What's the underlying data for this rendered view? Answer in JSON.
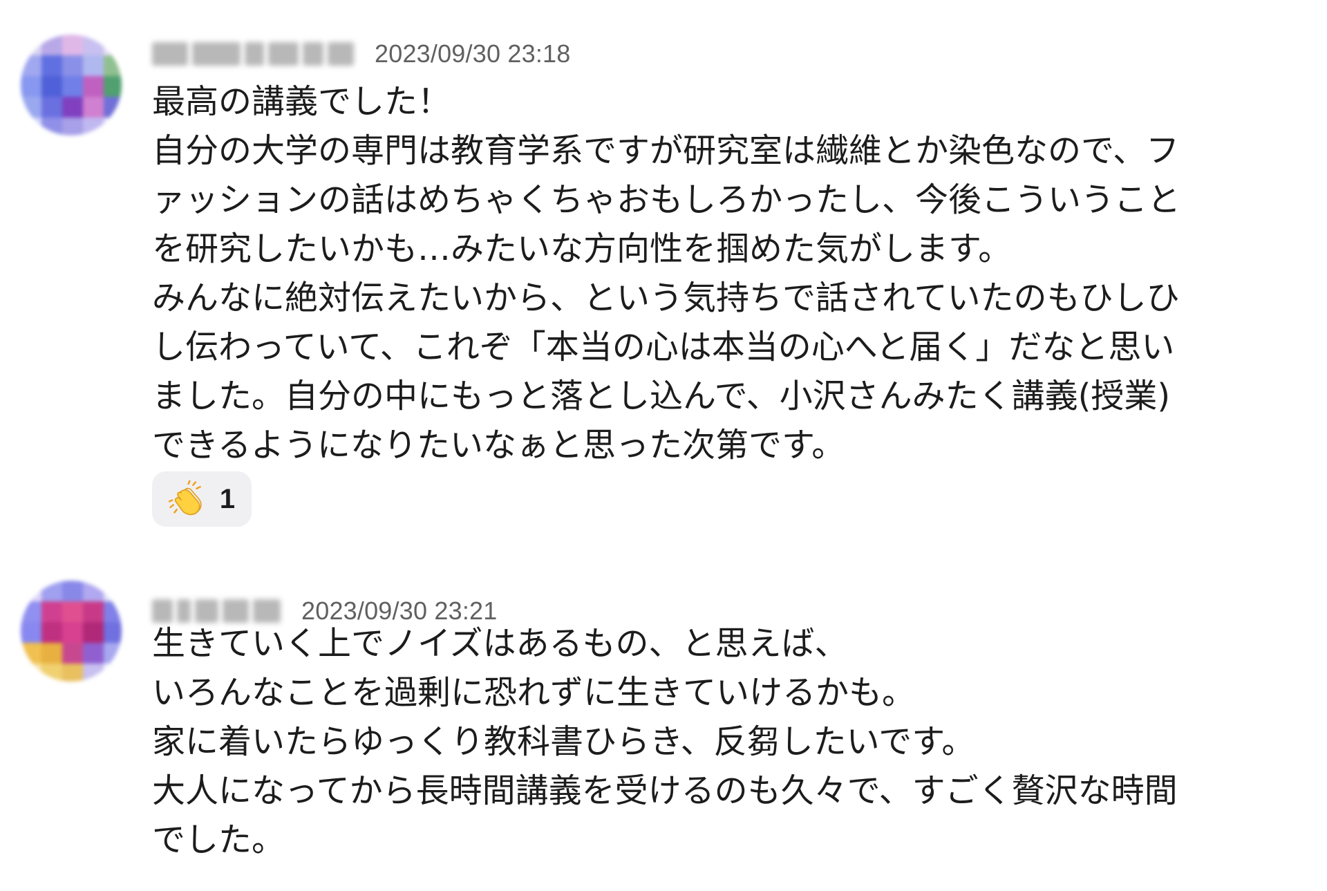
{
  "messages": [
    {
      "author_name": "",
      "timestamp": "2023/09/30 23:18",
      "text": "最高の講義でした！\n自分の大学の専門は教育学系ですが研究室は繊維とか染色なので、フ\nァッションの話はめちゃくちゃおもしろかったし、今後こういうこと\nを研究したいかも…みたいな方向性を掴めた気がします。\nみんなに絶対伝えたいから、という気持ちで話されていたのもひしひ\nし伝わっていて、これぞ「本当の心は本当の心へと届く」だなと思い\nました。自分の中にもっと落とし込んで、小沢さんみたく講義(授業)\nできるようになりたいなぁと思った次第です。",
      "reaction": {
        "emoji": "clapping-hands",
        "count": "1"
      }
    },
    {
      "author_name": "",
      "timestamp": "2023/09/30 23:21",
      "text": "生きていく上でノイズはあるもの、と思えば、\nいろんなことを過剰に恐れずに生きていけるかも。\n家に着いたらゆっくり教科書ひらき、反芻したいです。\n大人になってから長時間講義を受けるのも久々で、すごく贅沢な時間\nでした。"
    }
  ],
  "colors": {
    "text": "#1d1c1d",
    "timestamp": "#616061",
    "reaction_bg": "#f0f0f2"
  }
}
